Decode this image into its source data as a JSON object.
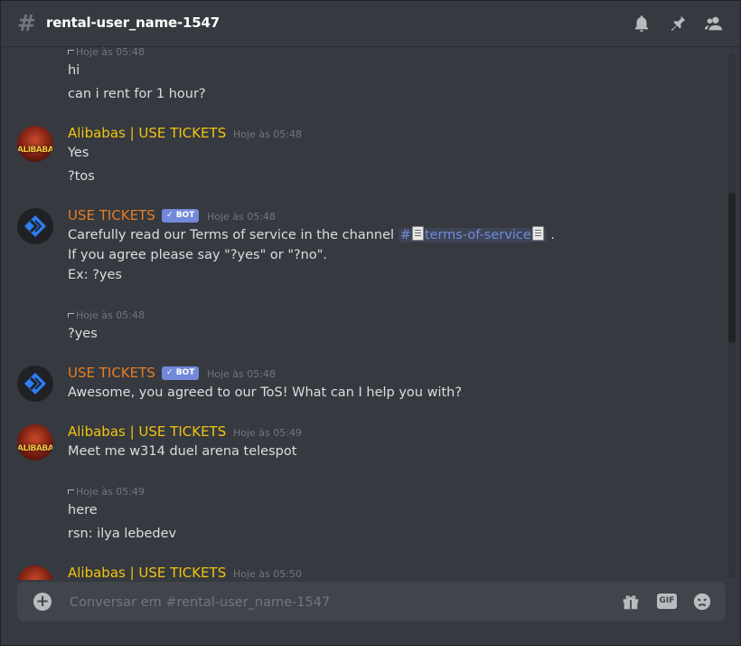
{
  "header": {
    "channel_name": "rental-user_name-1547",
    "icons": [
      "bell-icon",
      "pin-icon",
      "members-icon"
    ]
  },
  "messages": [
    {
      "type": "continuation",
      "timestamp": "Hoje às 05:48",
      "lines": [
        "hi",
        "can i rent for 1 hour?"
      ]
    },
    {
      "type": "author",
      "author": "Alibabas | USE TICKETS",
      "timestamp": "Hoje às 05:48",
      "lines": [
        "Yes",
        "?tos"
      ]
    },
    {
      "type": "author",
      "author": "USE TICKETS",
      "bot_tag": "BOT",
      "timestamp": "Hoje às 05:48",
      "lines": [
        "Carefully read our Terms of service in the channel",
        "If you agree please say \"?yes\" or \"?no\".",
        "Ex: ?yes"
      ],
      "channel_mention": "#",
      "channel_mention_name": "terms-of-service",
      "trailing": "."
    },
    {
      "type": "continuation",
      "timestamp": "Hoje às 05:48",
      "lines": [
        "?yes"
      ]
    },
    {
      "type": "author",
      "author": "USE TICKETS",
      "bot_tag": "BOT",
      "timestamp": "Hoje às 05:48",
      "lines": [
        "Awesome, you agreed to our ToS! What can I help you with?"
      ]
    },
    {
      "type": "author",
      "author": "Alibabas | USE TICKETS",
      "timestamp": "Hoje às 05:49",
      "lines": [
        "Meet me w314 duel arena telespot"
      ]
    },
    {
      "type": "continuation",
      "timestamp": "Hoje às 05:49",
      "lines": [
        "here",
        "rsn: ilya lebedev"
      ]
    },
    {
      "type": "author",
      "author": "Alibabas | USE TICKETS",
      "timestamp": "Hoje às 05:50",
      "lines": []
    }
  ],
  "composer": {
    "placeholder": "Conversar em #rental-user_name-1547",
    "gif_label": "GIF"
  },
  "colors": {
    "background": "#36393f",
    "alibabas_name": "#f1c40f",
    "bot_name": "#e67e22",
    "bot_tag": "#7289da",
    "mention": "#7289da"
  }
}
